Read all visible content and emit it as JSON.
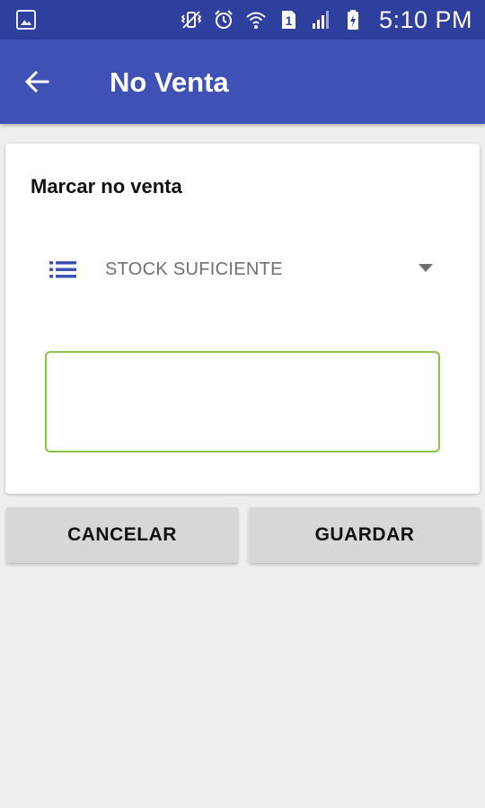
{
  "status_bar": {
    "time": "5:10 PM",
    "sim_slot": "1",
    "icons": [
      "gallery-icon",
      "vibrate-icon",
      "alarm-icon",
      "wifi-icon",
      "sim-icon",
      "signal-icon",
      "battery-charging-icon"
    ]
  },
  "app_bar": {
    "title": "No Venta",
    "back_icon": "arrow-left-icon"
  },
  "card": {
    "title": "Marcar no venta",
    "spinner": {
      "icon": "list-icon",
      "selected": "STOCK SUFICIENTE"
    },
    "note_input": {
      "value": ""
    }
  },
  "actions": {
    "cancel_label": "CANCELAR",
    "save_label": "GUARDAR"
  },
  "colors": {
    "status_bar": "#2f3f9e",
    "app_bar": "#3f51b5",
    "input_border": "#8bc34a",
    "background": "#eeeeee",
    "button": "#d6d7d7"
  }
}
